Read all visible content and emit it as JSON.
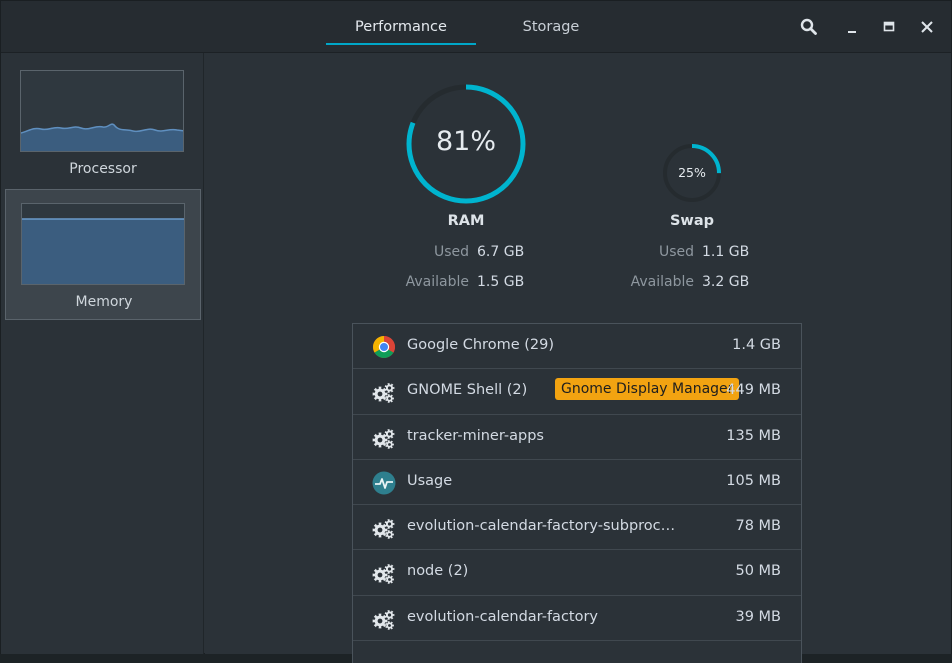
{
  "header": {
    "tabs": [
      {
        "label": "Performance",
        "active": true
      },
      {
        "label": "Storage",
        "active": false
      }
    ],
    "buttons": {
      "search": "search-icon",
      "minimize": "minimize-icon",
      "maximize": "maximize-icon",
      "close": "close-icon"
    }
  },
  "sidebar": {
    "items": [
      {
        "label": "Processor",
        "selected": false
      },
      {
        "label": "Memory",
        "selected": true
      }
    ]
  },
  "ram": {
    "title": "RAM",
    "percent": "81%",
    "percent_value": 81,
    "used_label": "Used",
    "used": "6.7 GB",
    "available_label": "Available",
    "available": "1.5 GB"
  },
  "swap": {
    "title": "Swap",
    "percent": "25%",
    "percent_value": 25,
    "used_label": "Used",
    "used": "1.1 GB",
    "available_label": "Available",
    "available": "3.2 GB"
  },
  "processes": [
    {
      "name": "Google Chrome (29)",
      "memory": "1.4 GB",
      "icon": "chrome-icon"
    },
    {
      "name": "GNOME Shell (2)",
      "memory": "449 MB",
      "icon": "gears-icon",
      "tooltip": "Gnome Display Manager"
    },
    {
      "name": "tracker-miner-apps",
      "memory": "135 MB",
      "icon": "gears-icon"
    },
    {
      "name": "Usage",
      "memory": "105 MB",
      "icon": "usage-icon"
    },
    {
      "name": "evolution-calendar-factory-subproc…",
      "memory": "78 MB",
      "icon": "gears-icon"
    },
    {
      "name": "node (2)",
      "memory": "50 MB",
      "icon": "gears-icon"
    },
    {
      "name": "evolution-calendar-factory",
      "memory": "39 MB",
      "icon": "gears-icon"
    }
  ],
  "colors": {
    "accent": "#00b4cf",
    "tooltip": "#f2a311",
    "graph": "#3b5d7f"
  }
}
